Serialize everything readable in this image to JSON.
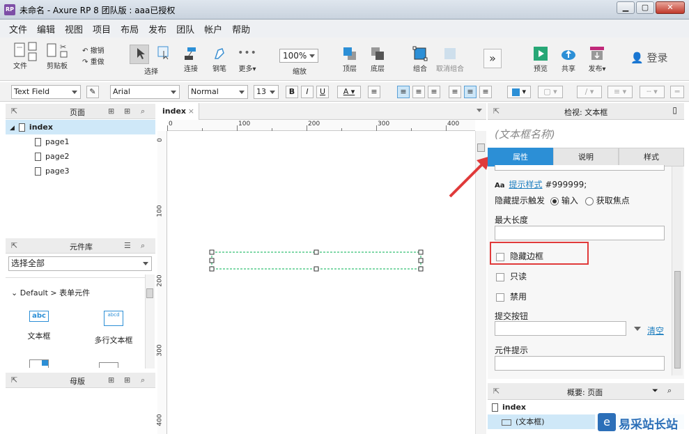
{
  "window": {
    "icon_text": "RP",
    "title": "未命名 - Axure RP 8 团队版 : aaa已授权"
  },
  "menu": [
    "文件",
    "编辑",
    "视图",
    "项目",
    "布局",
    "发布",
    "团队",
    "帐户",
    "帮助"
  ],
  "toolbar": {
    "file": "文件",
    "clipboard": "剪贴板",
    "undo": "撤销",
    "redo": "重做",
    "select": "选择",
    "connect": "连接",
    "pen": "钢笔",
    "more": "更多▾",
    "zoom_value": "100%",
    "zoom_label": "缩放",
    "front": "顶层",
    "back": "底层",
    "group": "组合",
    "ungroup": "取消组合",
    "preview": "预览",
    "share": "共享",
    "publish": "发布▾",
    "login": "登录"
  },
  "formatbar": {
    "widget_type": "Text Field",
    "font": "Arial",
    "weight": "Normal",
    "size": "13"
  },
  "pages_panel": {
    "title": "页面",
    "root": "index",
    "pages": [
      "page1",
      "page2",
      "page3"
    ]
  },
  "library_panel": {
    "title": "元件库",
    "select_value": "选择全部",
    "group": "Default > 表单元件",
    "items": [
      {
        "icon": "abc",
        "label": "文本框"
      },
      {
        "icon": "abcd",
        "label": "多行文本框"
      }
    ]
  },
  "masters_panel": {
    "title": "母版"
  },
  "canvas": {
    "tab": "index",
    "ruler_top": [
      "0",
      "100",
      "200",
      "300",
      "400"
    ],
    "ruler_left": [
      "0",
      "100",
      "200",
      "300",
      "400"
    ]
  },
  "inspector": {
    "title": "检视: 文本框",
    "name_placeholder": "(文本框名称)",
    "tabs": [
      "属性",
      "说明",
      "样式"
    ],
    "hint_style_link": "提示样式",
    "hint_color": "#999999;",
    "hide_hint_label": "隐藏提示触发",
    "radio_input": "输入",
    "radio_focus": "获取焦点",
    "max_length": "最大长度",
    "hide_border": "隐藏边框",
    "readonly": "只读",
    "disabled": "禁用",
    "submit_button": "提交按钮",
    "clear_link": "清空",
    "tooltip": "元件提示"
  },
  "outline_panel": {
    "title": "概要: 页面",
    "root": "index",
    "child": "(文本框)"
  },
  "watermark": "易采站长站",
  "colors": {
    "accent": "#2c8fd6",
    "highlight": "#e03a3a",
    "selection": "#00b050"
  }
}
